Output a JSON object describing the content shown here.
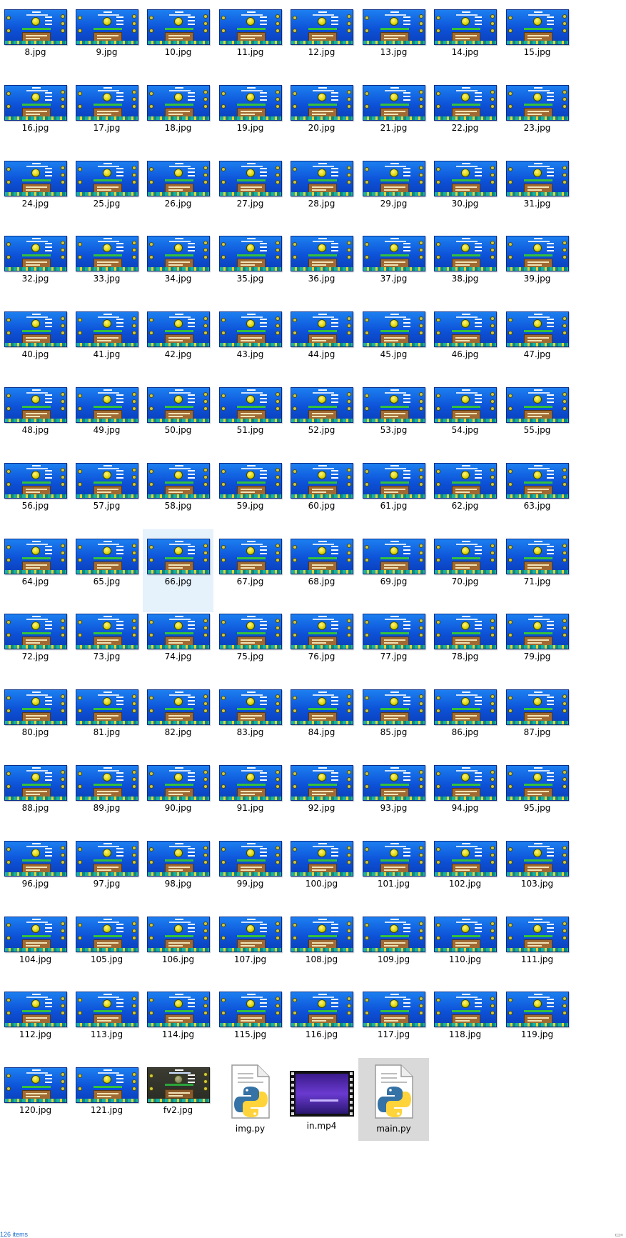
{
  "folder": {
    "thumbnail_files": [
      "8.jpg",
      "9.jpg",
      "10.jpg",
      "11.jpg",
      "12.jpg",
      "13.jpg",
      "14.jpg",
      "15.jpg",
      "16.jpg",
      "17.jpg",
      "18.jpg",
      "19.jpg",
      "20.jpg",
      "21.jpg",
      "22.jpg",
      "23.jpg",
      "24.jpg",
      "25.jpg",
      "26.jpg",
      "27.jpg",
      "28.jpg",
      "29.jpg",
      "30.jpg",
      "31.jpg",
      "32.jpg",
      "33.jpg",
      "34.jpg",
      "35.jpg",
      "36.jpg",
      "37.jpg",
      "38.jpg",
      "39.jpg",
      "40.jpg",
      "41.jpg",
      "42.jpg",
      "43.jpg",
      "44.jpg",
      "45.jpg",
      "46.jpg",
      "47.jpg",
      "48.jpg",
      "49.jpg",
      "50.jpg",
      "51.jpg",
      "52.jpg",
      "53.jpg",
      "54.jpg",
      "55.jpg",
      "56.jpg",
      "57.jpg",
      "58.jpg",
      "59.jpg",
      "60.jpg",
      "61.jpg",
      "62.jpg",
      "63.jpg",
      "64.jpg",
      "65.jpg",
      "66.jpg",
      "67.jpg",
      "68.jpg",
      "69.jpg",
      "70.jpg",
      "71.jpg",
      "72.jpg",
      "73.jpg",
      "74.jpg",
      "75.jpg",
      "76.jpg",
      "77.jpg",
      "78.jpg",
      "79.jpg",
      "80.jpg",
      "81.jpg",
      "82.jpg",
      "83.jpg",
      "84.jpg",
      "85.jpg",
      "86.jpg",
      "87.jpg",
      "88.jpg",
      "89.jpg",
      "90.jpg",
      "91.jpg",
      "92.jpg",
      "93.jpg",
      "94.jpg",
      "95.jpg",
      "96.jpg",
      "97.jpg",
      "98.jpg",
      "99.jpg",
      "100.jpg",
      "101.jpg",
      "102.jpg",
      "103.jpg",
      "104.jpg",
      "105.jpg",
      "106.jpg",
      "107.jpg",
      "108.jpg",
      "109.jpg",
      "110.jpg",
      "111.jpg",
      "112.jpg",
      "113.jpg",
      "114.jpg",
      "115.jpg",
      "116.jpg",
      "117.jpg",
      "118.jpg",
      "119.jpg",
      "120.jpg",
      "121.jpg",
      "fv2.jpg"
    ],
    "other_files": [
      {
        "name": "img.py",
        "icon": "python-file-icon"
      },
      {
        "name": "in.mp4",
        "icon": "video-file-icon"
      },
      {
        "name": "main.py",
        "icon": "python-file-icon"
      }
    ],
    "selected_file": "66.jpg",
    "highlighted_file": "main.py"
  },
  "status_bar": {
    "item_count": "126 items",
    "view_icon": "details-view-icon"
  },
  "colors": {
    "selection": "#e5f1fb",
    "highlight": "#d9d9d9",
    "python_blue": "#3572a5",
    "python_yellow": "#ffd43b"
  }
}
